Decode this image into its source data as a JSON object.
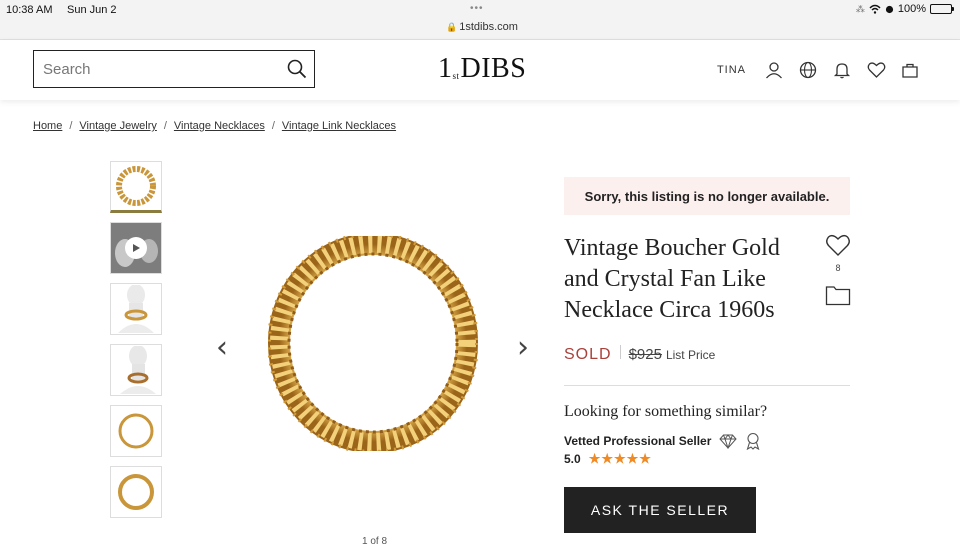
{
  "status_bar": {
    "time": "10:38 AM",
    "date": "Sun Jun 2",
    "url": "1stdibs.com",
    "battery": "100%"
  },
  "header": {
    "search_placeholder": "Search",
    "logo_main": "DIBS",
    "logo_one": "1",
    "logo_st": "st",
    "user_name": "TINA",
    "icons": [
      "search-icon",
      "user-icon",
      "globe-icon",
      "bell-icon",
      "heart-icon",
      "bag-icon"
    ]
  },
  "breadcrumb": {
    "items": [
      "Home",
      "Vintage Jewelry",
      "Vintage Necklaces",
      "Vintage Link Necklaces"
    ],
    "separator": "/"
  },
  "gallery": {
    "thumbnails": [
      "necklace-front",
      "video",
      "model-front",
      "model-side",
      "necklace-flat",
      "necklace-back"
    ],
    "counter": "1 of 8",
    "accent": "#c9963a"
  },
  "listing": {
    "notice": "Sorry, this listing is no longer available.",
    "title": "Vintage Boucher Gold and Crystal Fan Like Necklace Circa 1960s",
    "favorites_count": "8",
    "status": "SOLD",
    "status_color": "#a9413a",
    "price": "$925",
    "price_label": "List Price",
    "similar_heading": "Looking for something similar?",
    "seller_label": "Vetted Professional Seller",
    "rating": "5.0",
    "stars": "★★★★★",
    "ask_button": "ASK THE SELLER"
  }
}
